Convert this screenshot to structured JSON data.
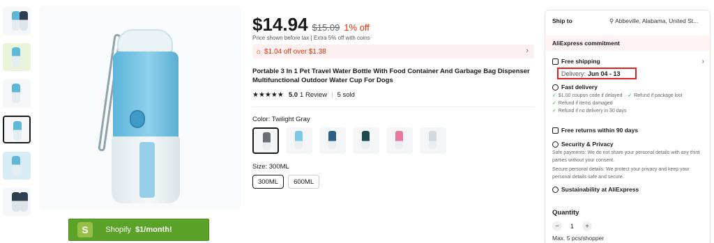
{
  "price": {
    "current": "$14.94",
    "original": "$15.09",
    "discount": "1% off",
    "note": "Price shown before tax  |  Extra 5% off with coins"
  },
  "coupon": {
    "text": "$1.04 off over $1.38"
  },
  "product": {
    "title": "Portable 3 In 1 Pet Travel Water Bottle With Food Container And Garbage Bag Dispenser Multifunctional Outdoor Water Cup For Dogs",
    "rating": "5.0",
    "reviews": "1 Review",
    "sold": "5 sold"
  },
  "variants": {
    "color_label": "Color: Twilight Gray",
    "colors": [
      "#6b6f73",
      "#7fc7e6",
      "#2b5f86",
      "#1f4a4a",
      "#e6789b",
      "#d5d9dc"
    ],
    "size_label": "Size: 300ML",
    "sizes": [
      "300ML",
      "600ML"
    ]
  },
  "shopify": {
    "prefix": "Shopify ",
    "bold": "$1/month!"
  },
  "shipping": {
    "ship_to_label": "Ship to",
    "location": "Abbeville, Alabama, United St...",
    "commitment": "AliExpress commitment",
    "free_shipping": "Free shipping",
    "delivery_label": "Delivery:",
    "delivery_date": "Jun 04 - 13",
    "fast_delivery": "Fast delivery",
    "fast_items": [
      "$1.00 coupon code if delayed",
      "Refund if package lost",
      "Refund if items damaged",
      "Refund if no delivery in 30 days"
    ],
    "free_returns": "Free returns within 90 days",
    "security_title": "Security & Privacy",
    "security_text1": "Safe payments: We do not share your personal details with any third parties without your consent.",
    "security_text2": "Secure personal details: We protect your privacy and keep your personal details safe and secure.",
    "sustainability": "Sustainability at AliExpress"
  },
  "quantity": {
    "label": "Quantity",
    "value": "1",
    "max": "Max. 5 pcs/shopper"
  }
}
